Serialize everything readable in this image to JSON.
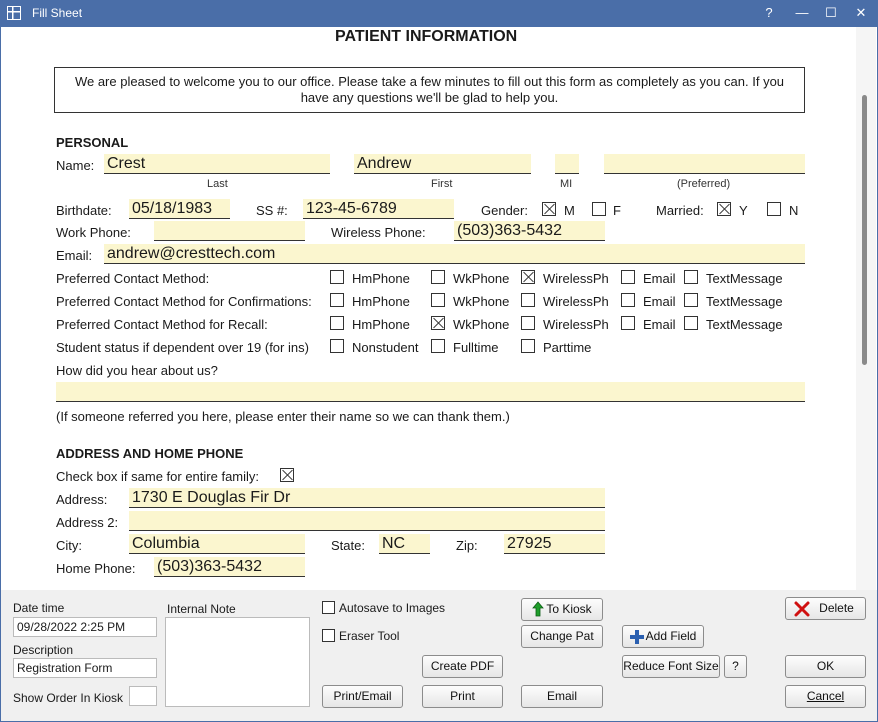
{
  "window": {
    "title": "Fill Sheet",
    "help": "?",
    "minimize": "—",
    "maximize": "☐",
    "close": "✕"
  },
  "sheet": {
    "title": "PATIENT INFORMATION",
    "intro": "We are pleased to welcome you to our office. Please take a few minutes to fill out this form as completely as you can. If you have any questions we'll be glad to help you.",
    "personal": {
      "header": "PERSONAL",
      "name_label": "Name:",
      "last": "Crest",
      "first": "Andrew",
      "mi": "",
      "preferred": "",
      "last_caption": "Last",
      "first_caption": "First",
      "mi_caption": "MI",
      "preferred_caption": "(Preferred)",
      "birthdate_label": "Birthdate:",
      "birthdate": "05/18/1983",
      "ss_label": "SS #:",
      "ss": "123-45-6789",
      "gender_label": "Gender:",
      "gender_m": "M",
      "gender_f": "F",
      "married_label": "Married:",
      "married_y": "Y",
      "married_n": "N",
      "work_phone_label": "Work Phone:",
      "work_phone": "",
      "wireless_label": "Wireless Phone:",
      "wireless": "(503)363-5432",
      "email_label": "Email:",
      "email": "andrew@cresttech.com",
      "contact_label": "Preferred Contact Method:",
      "confirm_label": "Preferred Contact Method for Confirmations:",
      "recall_label": "Preferred Contact Method for Recall:",
      "methods": [
        "HmPhone",
        "WkPhone",
        "WirelessPh",
        "Email",
        "TextMessage"
      ],
      "student_label": "Student status if dependent over 19 (for ins)",
      "student_opts": [
        "Nonstudent",
        "Fulltime",
        "Parttime"
      ],
      "hear_label": "How did you hear about us?",
      "hear_value": "",
      "referral_note": "(If someone referred you here, please enter their name so we can thank them.)"
    },
    "address": {
      "header": "ADDRESS AND HOME PHONE",
      "same_label": "Check box if same for entire family:",
      "address_label": "Address:",
      "address": "1730 E Douglas Fir Dr",
      "address2_label": "Address 2:",
      "address2": "",
      "city_label": "City:",
      "city": "Columbia",
      "state_label": "State:",
      "state": "NC",
      "zip_label": "Zip:",
      "zip": "27925",
      "home_phone_label": "Home Phone:",
      "home_phone": "(503)363-5432"
    }
  },
  "bottom": {
    "datetime_label": "Date time",
    "datetime": "09/28/2022 2:25 PM",
    "description_label": "Description",
    "description": "Registration Form",
    "show_order_label": "Show Order In Kiosk",
    "show_order": "",
    "internal_note_label": "Internal Note",
    "internal_note": "",
    "autosave_label": "Autosave to Images",
    "eraser_label": "Eraser Tool",
    "to_kiosk": "To Kiosk",
    "change_pat": "Change Pat",
    "add_field": "Add Field",
    "create_pdf": "Create PDF",
    "reduce_font": "Reduce Font Size",
    "help": "?",
    "print_email": "Print/Email",
    "print": "Print",
    "email": "Email",
    "delete": "Delete",
    "ok": "OK",
    "cancel": "Cancel"
  },
  "colors": {
    "titlebar": "#4a6ea8",
    "field": "#fbf6cf",
    "delete_x": "#d01010",
    "kiosk_arrow": "#1e9e2a",
    "add_plus": "#2a5fb0"
  }
}
